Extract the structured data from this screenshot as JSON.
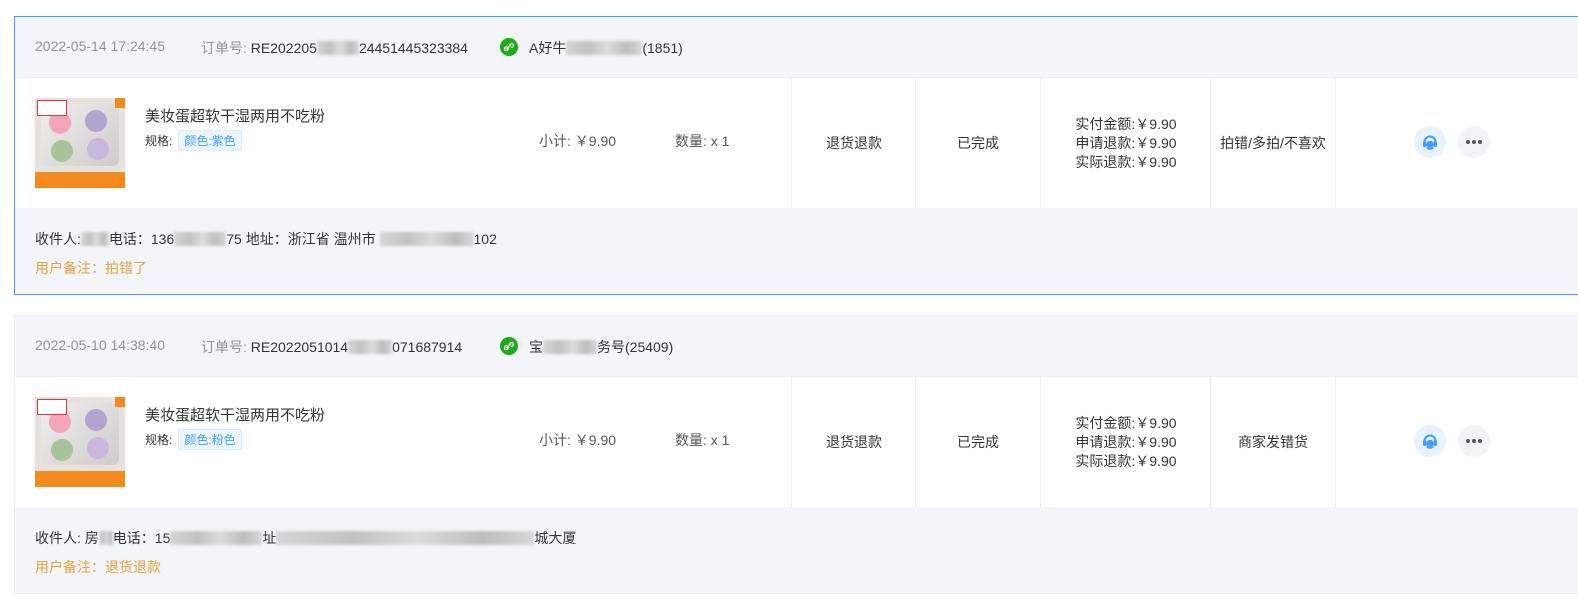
{
  "orders": [
    {
      "time": "2022-05-14 17:24:45",
      "order_no_label": "订单号:",
      "order_no_visible_start": "RE202205",
      "order_no_visible_end": "24451445323384",
      "shop_visible_start": "A好牛",
      "shop_visible_end": "(1851)",
      "product": {
        "name": "美妆蛋超软干湿两用不吃粉",
        "spec_label": "规格:",
        "spec_value": "颜色:紫色",
        "subtotal_label": "小计:",
        "subtotal_value": "￥9.90",
        "qty_label": "数量:",
        "qty_value": "x 1"
      },
      "refund_type": "退货退款",
      "status": "已完成",
      "amounts": {
        "paid": "实付金额:￥9.90",
        "requested": "申请退款:￥9.90",
        "actual": "实际退款:￥9.90"
      },
      "reason": "拍错/多拍/不喜欢",
      "receiver_parts": [
        "收件人:",
        "电话：136",
        "75 地址：浙江省 温州市 ",
        "102"
      ],
      "note": "用户备注：拍错了",
      "selected": true
    },
    {
      "time": "2022-05-10 14:38:40",
      "order_no_label": "订单号:",
      "order_no_visible_start": "RE2022051014",
      "order_no_visible_end": "071687914",
      "shop_visible_start": "宝",
      "shop_visible_end": "务号(25409)",
      "product": {
        "name": "美妆蛋超软干湿两用不吃粉",
        "spec_label": "规格:",
        "spec_value": "颜色:粉色",
        "subtotal_label": "小计:",
        "subtotal_value": "￥9.90",
        "qty_label": "数量:",
        "qty_value": "x 1"
      },
      "refund_type": "退货退款",
      "status": "已完成",
      "amounts": {
        "paid": "实付金额:￥9.90",
        "requested": "申请退款:￥9.90",
        "actual": "实际退款:￥9.90"
      },
      "reason": "商家发错货",
      "receiver_parts": [
        "收件人: 房",
        "电话：15",
        "址",
        "城大厦"
      ],
      "note": "用户备注：退货退款",
      "selected": false
    }
  ],
  "icons": {
    "channel": "wechat-miniprogram-icon",
    "service": "customer-service-icon",
    "more": "more-icon"
  },
  "colors": {
    "selected_border": "#409eff",
    "note": "#e6a23c",
    "tag": "#409eff",
    "channel_icon": "#1aad19"
  }
}
